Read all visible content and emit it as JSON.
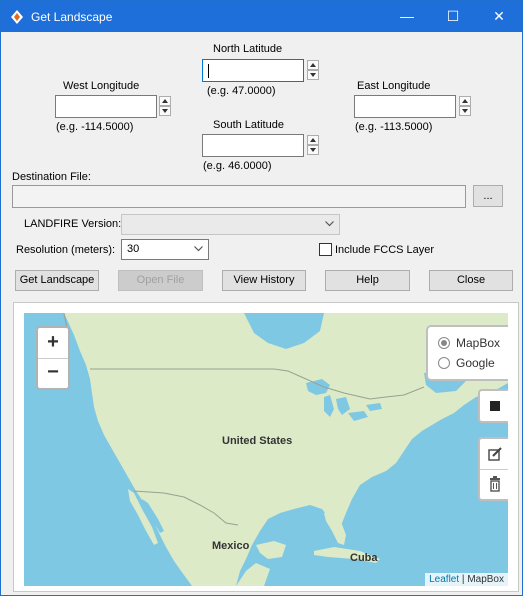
{
  "window": {
    "title": "Get Landscape",
    "minimize_glyph": "—",
    "maximize_glyph": "☐",
    "close_glyph": "✕"
  },
  "coords": {
    "north": {
      "label": "North Latitude",
      "value": "",
      "example": "(e.g. 47.0000)"
    },
    "west": {
      "label": "West Longitude",
      "value": "",
      "example": "(e.g. -114.5000)"
    },
    "east": {
      "label": "East Longitude",
      "value": "",
      "example": "(e.g. -113.5000)"
    },
    "south": {
      "label": "South Latitude",
      "value": "",
      "example": "(e.g. 46.0000)"
    }
  },
  "destination": {
    "label": "Destination File:",
    "value": "",
    "browse_label": "..."
  },
  "landfire": {
    "label": "LANDFIRE Version:",
    "value": ""
  },
  "resolution": {
    "label": "Resolution (meters):",
    "value": "30"
  },
  "fccs": {
    "label": "Include FCCS Layer",
    "checked": false
  },
  "buttons": {
    "get_landscape": "Get Landscape",
    "open_file": "Open File",
    "view_history": "View History",
    "help": "Help",
    "close": "Close"
  },
  "map": {
    "zoom_in": "+",
    "zoom_out": "−",
    "layers": {
      "mapbox": "MapBox",
      "google": "Google",
      "selected": "MapBox"
    },
    "labels": {
      "us": "United States",
      "mexico": "Mexico",
      "cuba": "Cuba"
    },
    "attribution": {
      "leaflet": "Leaflet",
      "separator": " | ",
      "provider": "MapBox"
    },
    "colors": {
      "water": "#7ec8e3",
      "land": "#ddeac7",
      "border": "#9aa090"
    }
  },
  "icons": {
    "app": "landfire-app-icon",
    "rectangle": "rectangle-draw-icon",
    "edit": "edit-layer-icon",
    "delete": "trash-icon"
  }
}
